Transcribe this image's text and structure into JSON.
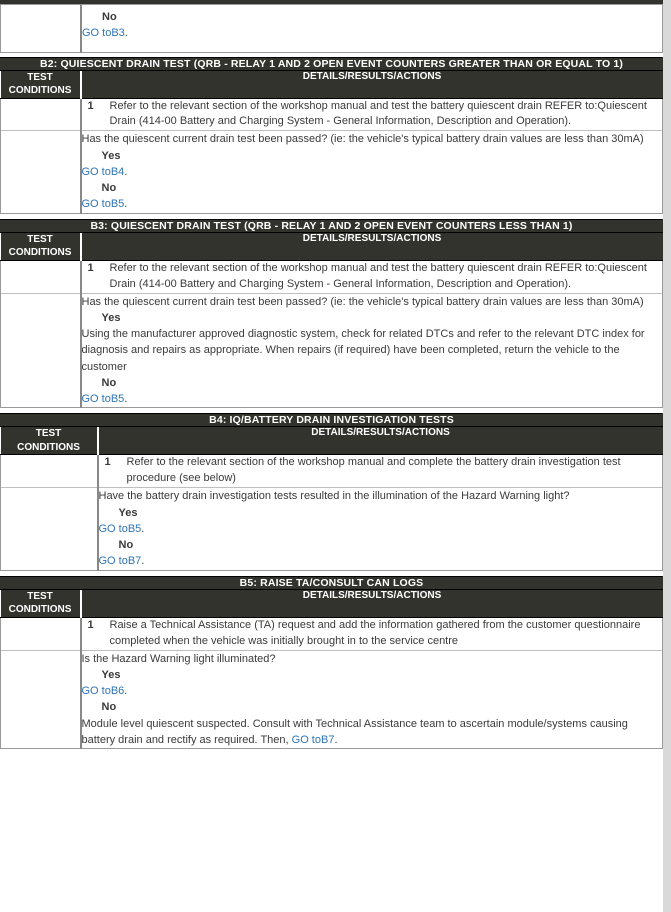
{
  "document": {
    "type": "diagnostic-test-procedure-table",
    "column_headers": {
      "left": "TEST\nCONDITIONS",
      "left_line1": "TEST",
      "left_line2": "CONDITIONS",
      "right": "DETAILS/RESULTS/ACTIONS"
    },
    "colors": {
      "header_bar": "#33332e",
      "header_text": "#ffffff",
      "link": "#2e74b5",
      "body_text": "#3a3a3a",
      "grid_line": "#9a9a9a",
      "row_separator": "#bfbfbf",
      "page_margin": "#d9d9d9"
    }
  },
  "partial_top_block": {
    "answer_label": "No",
    "goto_text": "GO toB3",
    "goto_period": "."
  },
  "sections": [
    {
      "id": "B2",
      "title": "B2: QUIESCENT DRAIN TEST (QRB - RELAY 1 AND 2 OPEN EVENT COUNTERS GREATER THAN OR EQUAL TO 1)",
      "left_column_width": 79,
      "steps": [
        {
          "number": "1",
          "text": "Refer to the relevant section of the workshop manual and test the battery quiescent drain REFER to:Quiescent Drain (414-00 Battery and Charging System - General Information, Description and Operation)."
        }
      ],
      "question": "Has the quiescent current drain test been passed? (ie: the vehicle's typical battery drain values are less than 30mA)",
      "answers": [
        {
          "label": "Yes",
          "lines": [
            {
              "kind": "goto",
              "link": "GO toB4",
              "after": "."
            }
          ]
        },
        {
          "label": "No",
          "lines": [
            {
              "kind": "goto",
              "link": "GO toB5",
              "after": "."
            }
          ]
        }
      ]
    },
    {
      "id": "B3",
      "title": "B3: QUIESCENT DRAIN TEST (QRB - RELAY 1 AND 2 OPEN EVENT COUNTERS LESS THAN 1)",
      "left_column_width": 79,
      "steps": [
        {
          "number": "1",
          "text": "Refer to the relevant section of the workshop manual and test the battery quiescent drain REFER to:Quiescent Drain (414-00 Battery and Charging System - General Information, Description and Operation)."
        }
      ],
      "question": "Has the quiescent current drain test been passed? (ie: the vehicle's typical battery drain values are less than 30mA)",
      "answers": [
        {
          "label": "Yes",
          "lines": [
            {
              "kind": "para",
              "text": "Using the manufacturer approved diagnostic system, check for related DTCs and refer to the relevant DTC index for diagnosis and repairs as appropriate. When repairs (if required) have been completed, return the vehicle to the customer"
            }
          ]
        },
        {
          "label": "No",
          "lines": [
            {
              "kind": "goto",
              "link": "GO toB5",
              "after": "."
            }
          ]
        }
      ]
    },
    {
      "id": "B4",
      "title": "B4: IQ/BATTERY DRAIN INVESTIGATION TESTS",
      "left_column_width": 96,
      "steps": [
        {
          "number": "1",
          "text": "Refer to the relevant section of the workshop manual and complete the battery drain investigation test procedure (see below)"
        }
      ],
      "question": "Have the battery drain investigation tests resulted in the illumination of the Hazard Warning light?",
      "answers": [
        {
          "label": "Yes",
          "lines": [
            {
              "kind": "goto",
              "link": "GO toB5",
              "after": "."
            }
          ]
        },
        {
          "label": "No",
          "lines": [
            {
              "kind": "goto",
              "link": "GO toB7",
              "after": "."
            }
          ]
        }
      ]
    },
    {
      "id": "B5",
      "title": "B5: RAISE TA/CONSULT CAN LOGS",
      "left_column_width": 79,
      "steps": [
        {
          "number": "1",
          "text": "Raise a Technical Assistance (TA) request and add the information gathered from the customer questionnaire completed when the vehicle was initially brought in to the service centre"
        }
      ],
      "question": "Is the Hazard Warning light illuminated?",
      "answers": [
        {
          "label": "Yes",
          "lines": [
            {
              "kind": "goto",
              "link": "GO toB6",
              "after": "."
            }
          ]
        },
        {
          "label": "No",
          "lines": [
            {
              "kind": "para-with-link",
              "before": "Module level quiescent suspected. Consult with Technical Assistance team to ascertain module/systems causing battery drain and rectify as required. Then, ",
              "link": "GO toB7",
              "after": "."
            }
          ]
        }
      ]
    }
  ]
}
